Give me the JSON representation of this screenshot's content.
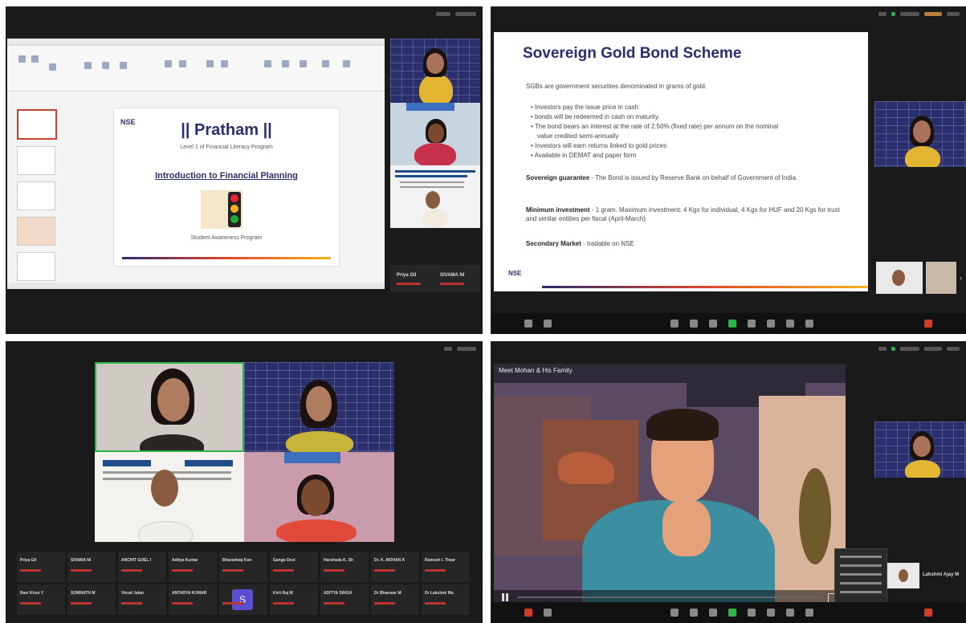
{
  "q1": {
    "slide_logo": "NSE",
    "slide_title": "|| Pratham ||",
    "slide_subtitle": "Level 1 of Financial Literacy Program",
    "slide_heading": "Introduction to Financial Planning",
    "slide_footer": "Student Awareness Program",
    "participants": [
      {
        "name": "Priya Gil"
      },
      {
        "name": "SIVAMA NI"
      }
    ]
  },
  "q2": {
    "title": "Sovereign Gold Bond Scheme",
    "intro": "SGBs are government securities denominated in grams of gold.",
    "bullets": [
      "Investors pay the issue price in cash",
      "bonds will be redeemed in cash on maturity.",
      "The bond bears an interest at the rate of 2.50% (fixed rate) per annum on the nominal",
      "value credited semi-annually",
      "Investors will earn returns linked to gold prices",
      "Available in DEMAT and paper form"
    ],
    "guarantee_label": "Sovereign guarantee",
    "guarantee_text": " - The Bond is issued by Reserve Bank on behalf of Government of India.",
    "investment_label": "Minimum investment",
    "investment_text": " - 1 gram. Maximum investment: 4 Kgs for individual, 4 Kgs for HUF and 20 Kgs for trust and similar entities per fiscal (April-March)",
    "market_label": "Secondary Market",
    "market_text": " - tradable on NSE",
    "logo": "NSE"
  },
  "q3": {
    "avatar_letter": "S",
    "participants_row1": [
      "Priya Gil",
      "SIVAMA NI",
      "ANCHIT GOEL I",
      "Aditya Kumar",
      "Bharadwaj Kon",
      "Ganga Devi",
      "Harshada K. Sh",
      "Dr. K. MOHAN K",
      "Ramesh I. Tiwar"
    ],
    "participants_row2": [
      "Ravi Kiran Y",
      "SOMNATH M",
      "Vinod Jalan",
      "ANTARYA KUMAR",
      "",
      "Kirti Raj M",
      "ADITYA SINGH",
      "Dr Bhanwar M",
      "Dr Lakshmi Mu"
    ]
  },
  "q4": {
    "video_title": "Meet Mohan & His Family",
    "side_name": "Lakshmi Ajay M"
  }
}
